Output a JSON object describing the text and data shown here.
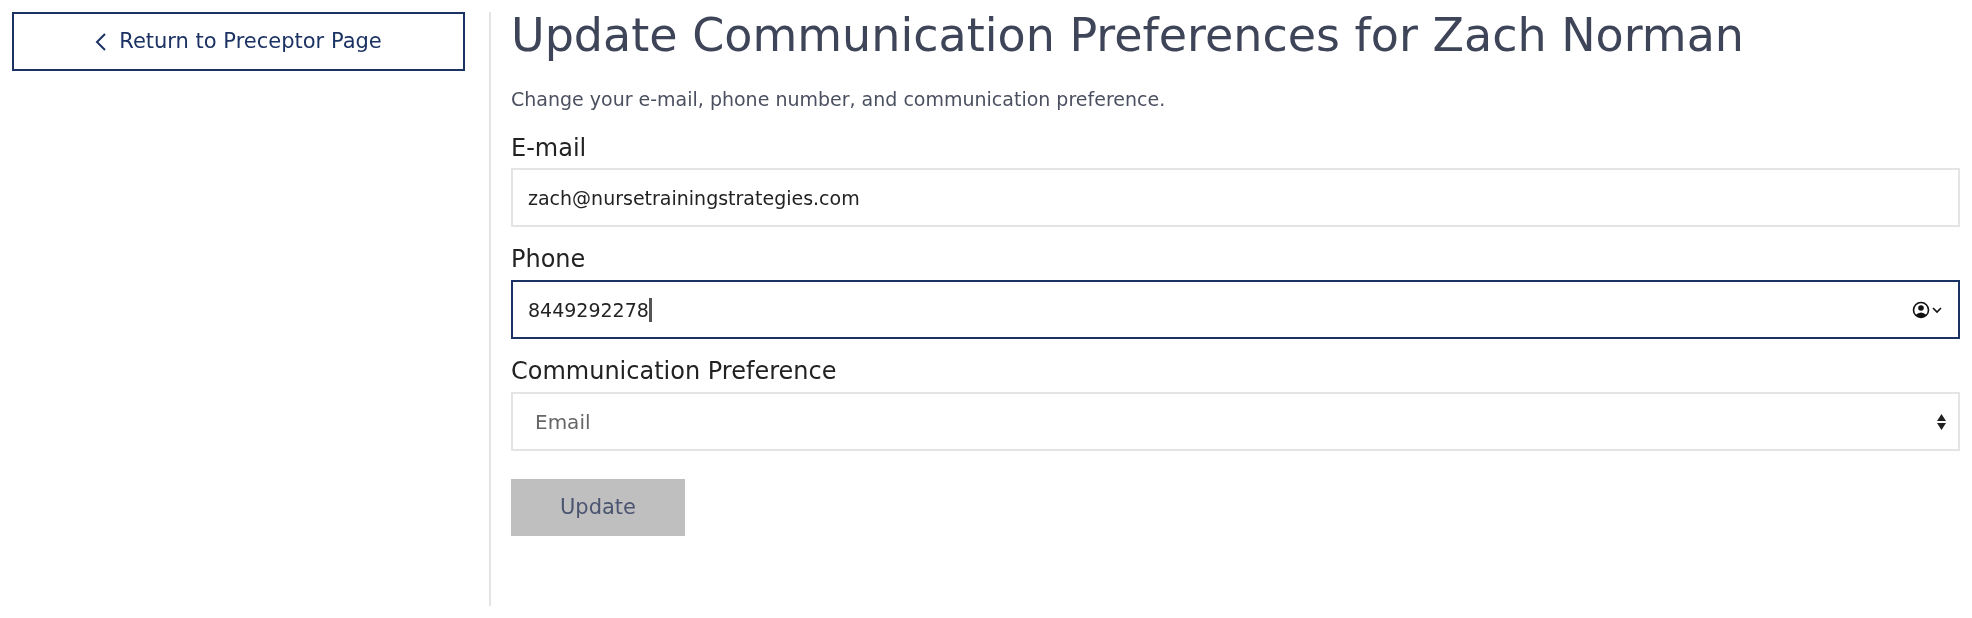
{
  "back_button": {
    "label": "Return to Preceptor Page"
  },
  "title": "Update Communication Preferences for Zach Norman",
  "description": "Change your e-mail, phone number, and communication preference.",
  "fields": [
    {
      "kind": "text",
      "label": "E-mail",
      "value": "zach@nursetrainingstrategies.com",
      "focused": false
    },
    {
      "kind": "phone",
      "label": "Phone",
      "value": "8449292278",
      "focused": true
    },
    {
      "kind": "select",
      "label": "Communication Preference",
      "value": "Email",
      "focused": false
    }
  ],
  "submit_button": {
    "label": "Update",
    "disabled": true
  }
}
